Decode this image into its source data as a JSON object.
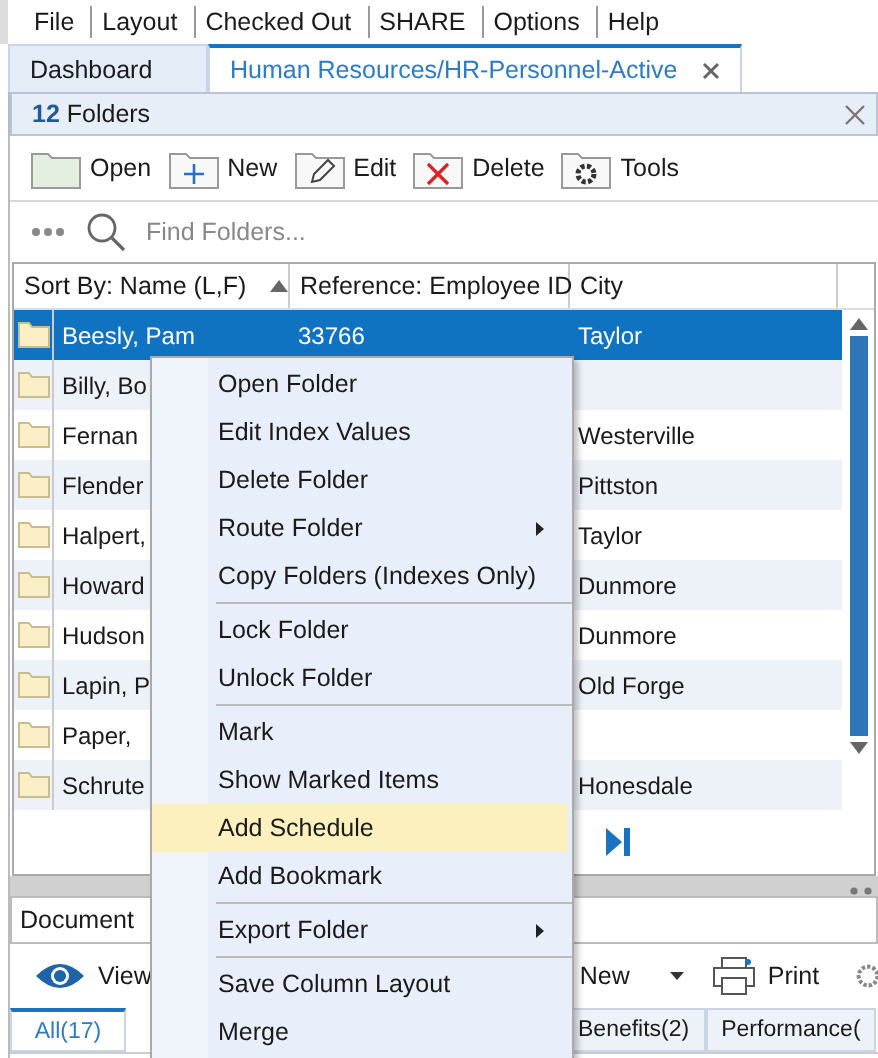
{
  "menu_bar": [
    "File",
    "Layout",
    "Checked Out",
    "SHARE",
    "Options",
    "Help"
  ],
  "tabs": [
    {
      "label": "Dashboard",
      "selected": false,
      "closable": false
    },
    {
      "label": "Human Resources/HR-Personnel-Active",
      "selected": true,
      "closable": true
    }
  ],
  "panel": {
    "count": "12",
    "title": "Folders"
  },
  "toolbar": [
    "Open",
    "New",
    "Edit",
    "Delete",
    "Tools"
  ],
  "search": {
    "placeholder": "Find Folders..."
  },
  "table": {
    "columns": [
      "Sort By: Name (L,F)",
      "Reference: Employee ID",
      "City"
    ],
    "rows": [
      {
        "name": "Beesly, Pam",
        "id": "33766",
        "city": "Taylor",
        "selected": true
      },
      {
        "name": "Billy, Bo",
        "selected": false
      },
      {
        "name": "Fernan",
        "city": "Westerville",
        "selected": false
      },
      {
        "name": "Flender",
        "city": "Pittston",
        "selected": false
      },
      {
        "name": "Halpert,",
        "city": "Taylor",
        "selected": false
      },
      {
        "name": "Howard",
        "city": "Dunmore",
        "selected": false
      },
      {
        "name": "Hudson",
        "city": "Dunmore",
        "selected": false
      },
      {
        "name": "Lapin, P",
        "city": "Old Forge",
        "selected": false
      },
      {
        "name": "Paper,",
        "selected": false
      },
      {
        "name": "Schrute",
        "city": "Honesdale",
        "selected": false
      }
    ]
  },
  "context_menu": [
    {
      "kind": "item",
      "label": "Open Folder",
      "selected": false,
      "submenu": false
    },
    {
      "kind": "item",
      "label": "Edit Index Values",
      "selected": false,
      "submenu": false
    },
    {
      "kind": "item",
      "label": "Delete Folder",
      "selected": false,
      "submenu": false
    },
    {
      "kind": "item",
      "label": "Route Folder",
      "selected": false,
      "submenu": true
    },
    {
      "kind": "item",
      "label": "Copy Folders (Indexes Only)",
      "selected": false,
      "submenu": false
    },
    {
      "kind": "separator"
    },
    {
      "kind": "item",
      "label": "Lock Folder",
      "selected": false,
      "submenu": false
    },
    {
      "kind": "item",
      "label": "Unlock Folder",
      "selected": false,
      "submenu": false
    },
    {
      "kind": "separator"
    },
    {
      "kind": "item",
      "label": "Mark",
      "selected": false,
      "submenu": false
    },
    {
      "kind": "item",
      "label": "Show Marked Items",
      "selected": false,
      "submenu": false
    },
    {
      "kind": "item",
      "label": "Add Schedule",
      "selected": true,
      "submenu": false
    },
    {
      "kind": "item",
      "label": "Add Bookmark",
      "selected": false,
      "submenu": false
    },
    {
      "kind": "separator"
    },
    {
      "kind": "item",
      "label": "Export Folder",
      "selected": false,
      "submenu": true
    },
    {
      "kind": "separator"
    },
    {
      "kind": "item",
      "label": "Save Column Layout",
      "selected": false,
      "submenu": false
    },
    {
      "kind": "item",
      "label": "Merge",
      "selected": false,
      "submenu": false
    }
  ],
  "document_list": {
    "title": "Document"
  },
  "doc_toolbar": [
    "View",
    "New",
    "Print"
  ],
  "doc_tabs": [
    {
      "label": "All(17)",
      "selected": true
    },
    {
      "label": "Benefits(2)",
      "selected": false
    },
    {
      "label": "Performance(",
      "selected": false
    }
  ]
}
